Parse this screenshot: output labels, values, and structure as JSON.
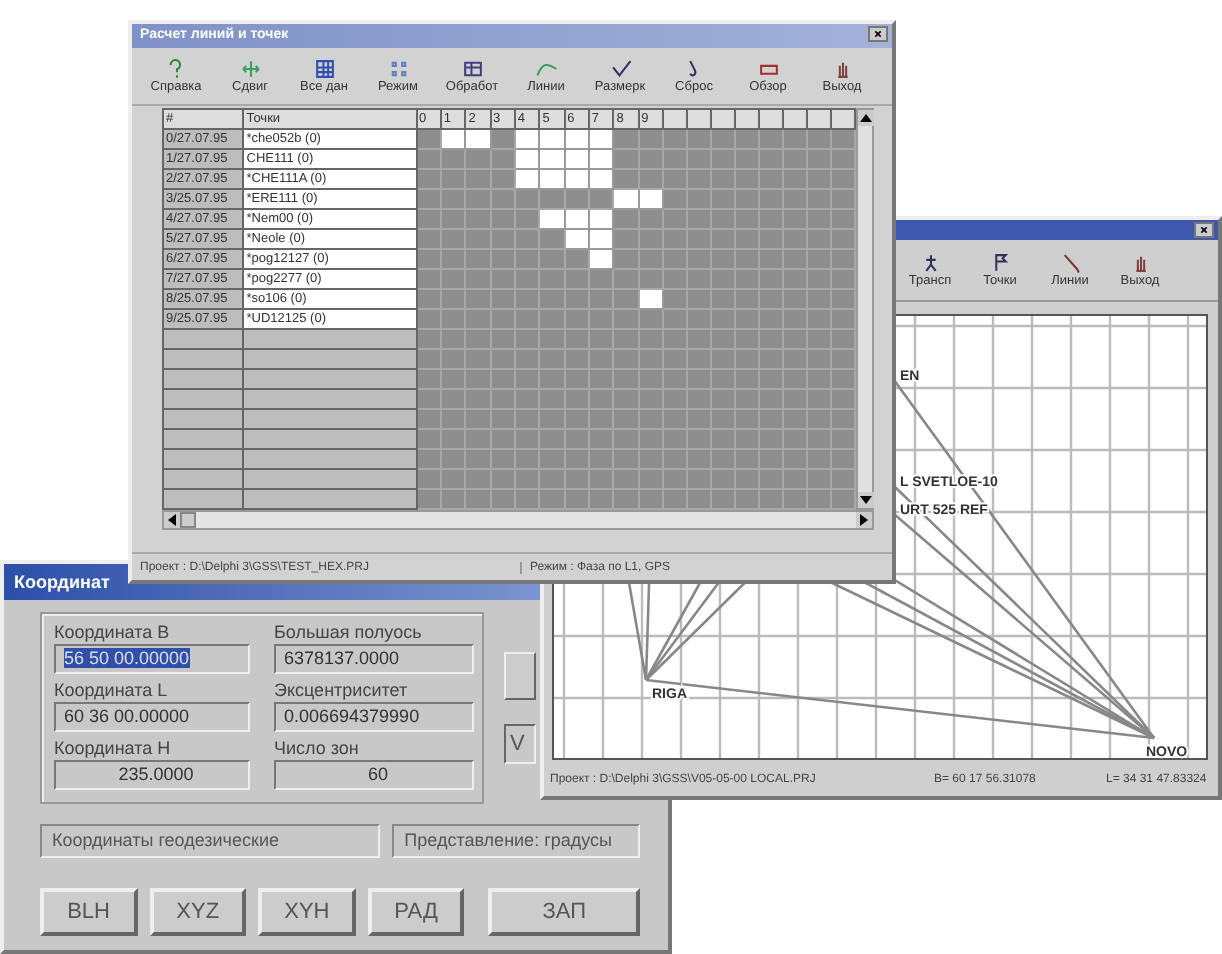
{
  "grid_window": {
    "title": "Расчет линий и точек",
    "toolbar": [
      {
        "label": "Справка"
      },
      {
        "label": "Сдвиг"
      },
      {
        "label": "Все дан"
      },
      {
        "label": "Режим"
      },
      {
        "label": "Обработ"
      },
      {
        "label": "Линии"
      },
      {
        "label": "Размерк"
      },
      {
        "label": "Сброс"
      },
      {
        "label": "Обзор"
      },
      {
        "label": "Выход"
      }
    ],
    "columns": [
      "#",
      "Точки",
      "0",
      "1",
      "2",
      "3",
      "4",
      "5",
      "6",
      "7",
      "8",
      "9"
    ],
    "rows": [
      {
        "index": "0/27.07.95",
        "point": "*che052b (0)",
        "cells": [
          false,
          true,
          true,
          false,
          true,
          true,
          true,
          true,
          false,
          false
        ]
      },
      {
        "index": "1/27.07.95",
        "point": "CHE111 (0)",
        "cells": [
          false,
          false,
          false,
          false,
          true,
          true,
          true,
          true,
          false,
          false
        ]
      },
      {
        "index": "2/27.07.95",
        "point": "*CHE111A (0)",
        "cells": [
          false,
          false,
          false,
          false,
          true,
          true,
          true,
          true,
          false,
          false
        ]
      },
      {
        "index": "3/25.07.95",
        "point": "*ERE111 (0)",
        "cells": [
          false,
          false,
          false,
          false,
          false,
          false,
          false,
          false,
          true,
          true
        ]
      },
      {
        "index": "4/27.07.95",
        "point": "*Nem00 (0)",
        "cells": [
          false,
          false,
          false,
          false,
          false,
          true,
          true,
          true,
          false,
          false
        ]
      },
      {
        "index": "5/27.07.95",
        "point": "*Neole (0)",
        "cells": [
          false,
          false,
          false,
          false,
          false,
          false,
          true,
          true,
          false,
          false
        ]
      },
      {
        "index": "6/27.07.95",
        "point": "*pog12127 (0)",
        "cells": [
          false,
          false,
          false,
          false,
          false,
          false,
          false,
          true,
          false,
          false
        ]
      },
      {
        "index": "7/27.07.95",
        "point": "*pog2277 (0)",
        "cells": [
          false,
          false,
          false,
          false,
          false,
          false,
          false,
          false,
          false,
          false
        ]
      },
      {
        "index": "8/25.07.95",
        "point": "*so106 (0)",
        "cells": [
          false,
          false,
          false,
          false,
          false,
          false,
          false,
          false,
          false,
          true
        ]
      },
      {
        "index": "9/25.07.95",
        "point": "*UD12125 (0)",
        "cells": [
          false,
          false,
          false,
          false,
          false,
          false,
          false,
          false,
          false,
          false
        ]
      }
    ],
    "status": [
      "Проект : D:\\Delphi 3\\GSS\\TEST_HEX.PRJ",
      "Режим : Фаза по L1, GPS"
    ]
  },
  "map_window": {
    "toolbar": [
      {
        "label": "Трансп"
      },
      {
        "label": "Точки"
      },
      {
        "label": "Линии"
      },
      {
        "label": "Выход"
      }
    ],
    "points": [
      {
        "label": "EN"
      },
      {
        "label": "L SVETLOE-10"
      },
      {
        "label": "URT 525 REF"
      },
      {
        "label": "RIGA"
      },
      {
        "label": "NOVO"
      }
    ],
    "status": [
      "Проект : D:\\Delphi 3\\GSS\\V05-05-00 LOCAL.PRJ",
      "B= 60 17 56.31078",
      "L= 34 31 47.83324"
    ]
  },
  "coords_window": {
    "title": "Координат",
    "fields": [
      {
        "label": "Координата B",
        "value": "56 50 00.00000",
        "selected": true
      },
      {
        "label": "Большая полуось",
        "value": "6378137.0000",
        "selected": false
      },
      {
        "label": "Координата L",
        "value": "60 36 00.00000",
        "selected": false
      },
      {
        "label": "Эксцентриситет",
        "value": "0.006694379990",
        "selected": false
      },
      {
        "label": "Координата H",
        "value": "235.0000",
        "selected": false
      },
      {
        "label": "Число зон",
        "value": "60",
        "selected": false
      }
    ],
    "side_field": {
      "value": "V"
    },
    "panels": [
      "Координаты геодезические",
      "Представление: градусы"
    ],
    "buttons": [
      "BLH",
      "XYZ",
      "XYH",
      "РАД",
      "ЗАП"
    ]
  }
}
